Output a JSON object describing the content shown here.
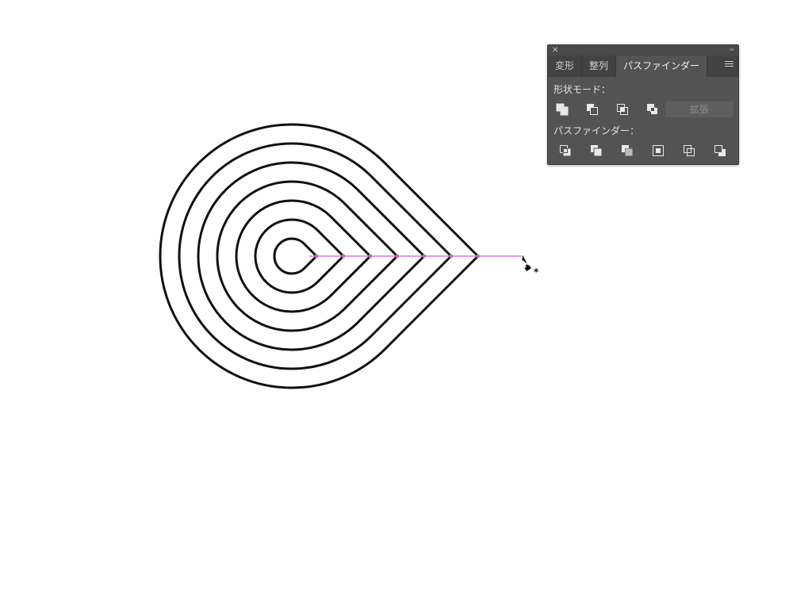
{
  "panel": {
    "close_icon": "close-icon",
    "collapse_label": "‹‹",
    "tabs": [
      {
        "label": "変形",
        "active": false
      },
      {
        "label": "整列",
        "active": false
      },
      {
        "label": "パスファインダー",
        "active": true
      }
    ],
    "shape_mode_label": "形状モード：",
    "pathfinder_label": "パスファインダー：",
    "expand_label": "拡張",
    "shape_mode_icons": [
      "unite-icon",
      "minus-front-icon",
      "intersect-icon",
      "exclude-icon"
    ],
    "pathfinder_icons": [
      "divide-icon",
      "trim-icon",
      "merge-icon",
      "crop-icon",
      "outline-icon",
      "minus-back-icon"
    ]
  },
  "artwork": {
    "shape": "concentric-teardrops",
    "ring_count": 7,
    "stroke_color": "#111111",
    "guide_color": "#d35bd3"
  },
  "cursor": {
    "tool": "pen-tool-icon",
    "modifier": "*"
  }
}
